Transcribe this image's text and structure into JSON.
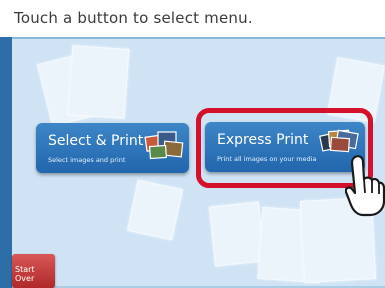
{
  "header": {
    "instruction": "Touch a button to select menu."
  },
  "buttons": [
    {
      "title": "Select & Print",
      "subtitle": "Select images and print"
    },
    {
      "title": "Express Print",
      "subtitle": "Print all images on your media"
    }
  ],
  "footer": {
    "start_over_label": "Start Over"
  },
  "colors": {
    "button_blue": "#2a70b5",
    "highlight_red": "#d4102a",
    "background_blue": "#cfe3f5",
    "start_red": "#c03c3c"
  }
}
